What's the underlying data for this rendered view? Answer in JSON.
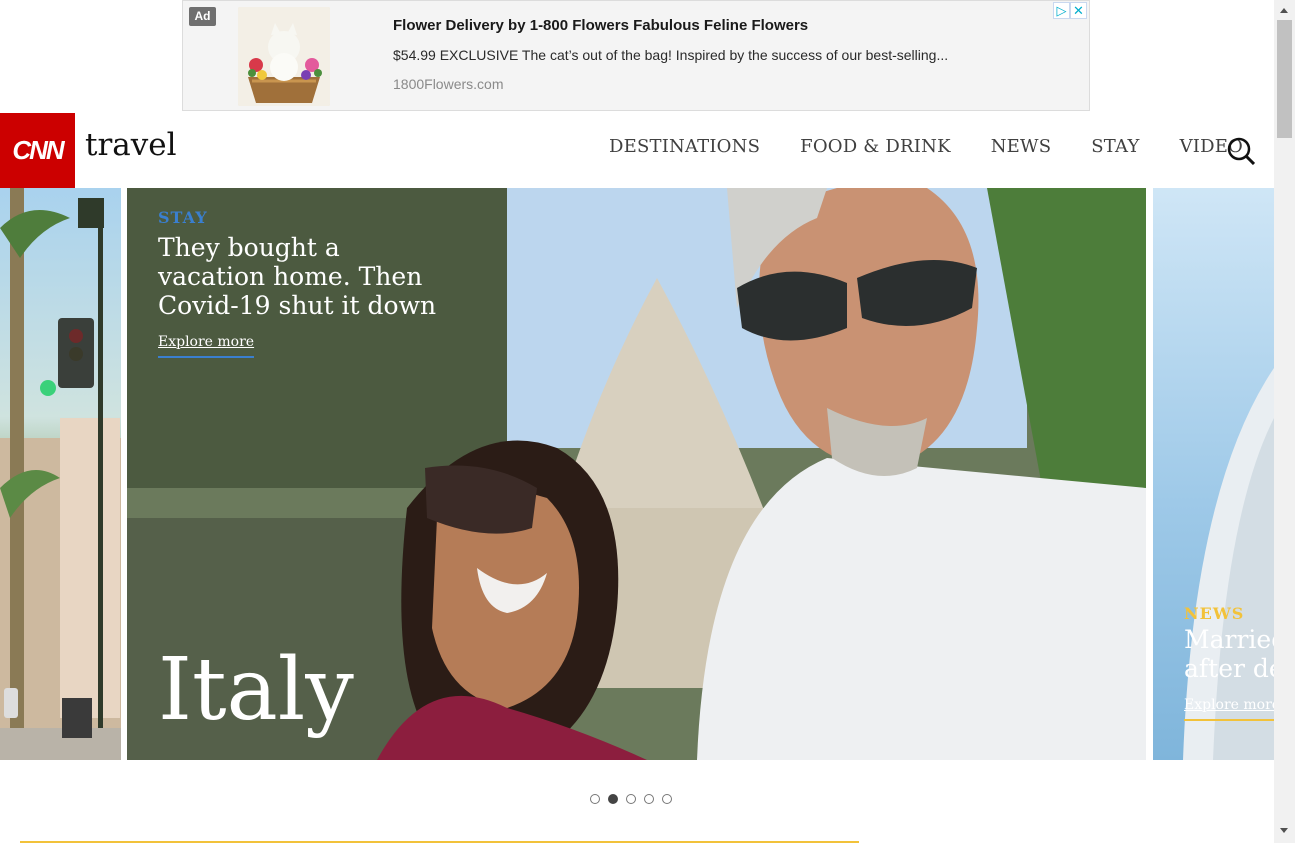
{
  "ad": {
    "badge": "Ad",
    "title": "Flower Delivery by 1-800 Flowers Fabulous Feline Flowers",
    "description": "$54.99 EXCLUSIVE The cat’s out of the bag! Inspired by the success of our best-selling...",
    "url": "1800Flowers.com",
    "choices_icon": "▷",
    "close_icon": "✕"
  },
  "header": {
    "logo": "CNN",
    "section": "travel",
    "nav": [
      "DESTINATIONS",
      "FOOD & DRINK",
      "NEWS",
      "STAY",
      "VIDEO"
    ],
    "search_icon": "search-icon"
  },
  "carousel": {
    "main": {
      "kicker": "STAY",
      "headline": "They bought a vacation home. Then Covid-19 shut it down",
      "cta": "Explore more",
      "destination": "Italy"
    },
    "next": {
      "kicker": "NEWS",
      "headline_line1": "Married",
      "headline_line2": "after dec",
      "cta": "Explore more"
    },
    "dots_total": 5,
    "active_dot": 2
  },
  "colors": {
    "cnn_red": "#cc0000",
    "stay_blue": "#3a7fcf",
    "news_gold": "#f2c23a"
  }
}
